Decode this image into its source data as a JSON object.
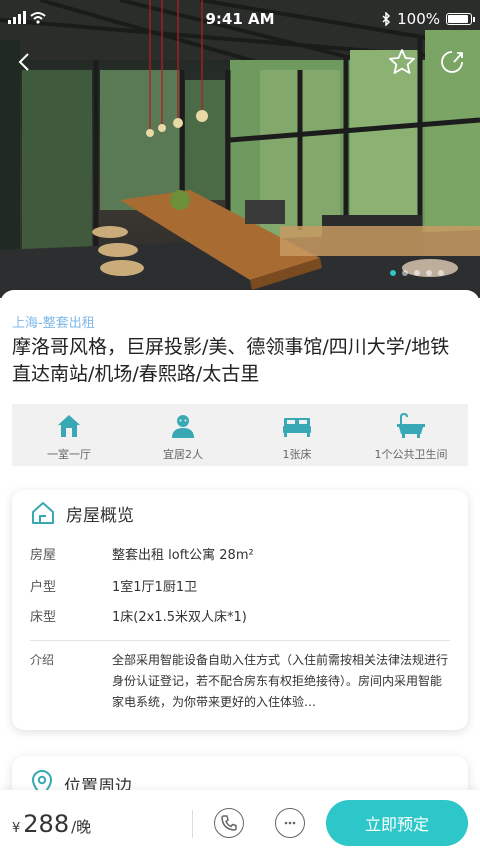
{
  "status_bar": {
    "time": "9:41 AM",
    "battery": "100%"
  },
  "hero": {
    "image_desc": "interior-photo",
    "slide_count": 5,
    "active_slide": 1
  },
  "listing": {
    "tag": "上海-整套出租",
    "title": "摩洛哥风格，巨屏投影/美、德领事馆/四川大学/地铁直达南站/机场/春熙路/太古里"
  },
  "features": [
    {
      "icon": "house-icon",
      "label": "一室一厅"
    },
    {
      "icon": "guests-icon",
      "label": "宜居2人"
    },
    {
      "icon": "bed-icon",
      "label": "1张床"
    },
    {
      "icon": "bathtub-icon",
      "label": "1个公共卫生间"
    }
  ],
  "overview": {
    "heading": "房屋概览",
    "rows": [
      {
        "key": "房屋",
        "value": "整套出租 loft公寓 28m²"
      },
      {
        "key": "户型",
        "value": "1室1厅1厨1卫"
      },
      {
        "key": "床型",
        "value": "1床(2x1.5米双人床*1)"
      }
    ],
    "intro_key": "介绍",
    "intro_value": "全部采用智能设备自助入住方式（入住前需按相关法律法规进行身份认证登记，若不配合房东有权拒绝接待）。房间内采用智能家电系统，为你带来更好的入住体验…"
  },
  "location": {
    "heading": "位置周边"
  },
  "bottom_bar": {
    "currency": "¥",
    "price": "288",
    "unit": "/晚",
    "book_label": "立即预定"
  },
  "colors": {
    "accent": "#2ec7c9",
    "tag": "#7fb8e8",
    "icon_teal": "#38a9b4"
  }
}
